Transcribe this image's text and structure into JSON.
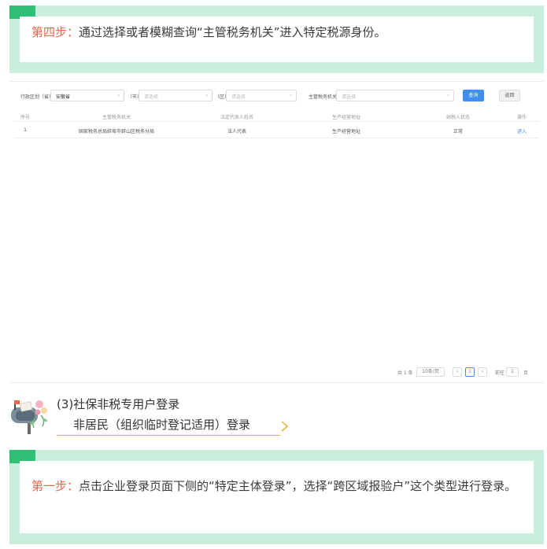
{
  "top_callout": {
    "step": "第四步：",
    "text": "通过选择或者模糊查询“主管税务机关”进入特定税源身份。"
  },
  "screenshot": {
    "filters": {
      "region_label": "行政区划（省）",
      "region_value": "安徽省",
      "city_label": "（市）",
      "city_placeholder": "请选择",
      "district_label": "（区）",
      "district_placeholder": "请选择",
      "authority_label": "主管税务机关",
      "authority_placeholder": "请选择",
      "query_button": "查询",
      "back_button": "返回"
    },
    "table": {
      "headers": [
        "序号",
        "主管税务机关",
        "法定代表人姓名",
        "生产经营地址",
        "纳税人状态",
        "操作"
      ],
      "rows": [
        {
          "index": "1",
          "authority": "国家税务总局蚌埠市蚌山区税务分局",
          "legal_rep": "法人代表",
          "address": "生产经营地址",
          "status": "正常",
          "action": "进入"
        }
      ]
    },
    "pagination": {
      "total": "共 1 条",
      "page_size": "10条/页",
      "prev": "‹",
      "page": "1",
      "next": "›",
      "goto_label": "前往",
      "goto_value": "1",
      "goto_unit": "页"
    }
  },
  "section": {
    "title": "(3)社保非税专用户登录",
    "subtitle": "非居民（组织临时登记适用）登录"
  },
  "bottom_callout": {
    "step": "第一步：",
    "text": "点击企业登录页面下侧的“特定主体登录”，选择“跨区域报验户”这个类型进行登录。"
  },
  "colors": {
    "accent_green": "#2fbf75",
    "light_green": "#c9eedb",
    "step_red": "#e8664a",
    "primary_blue": "#3f8ef0",
    "underline_gold": "#e6b84a"
  },
  "icons": [
    "mailbox-icon",
    "chevron-right-icon"
  ]
}
